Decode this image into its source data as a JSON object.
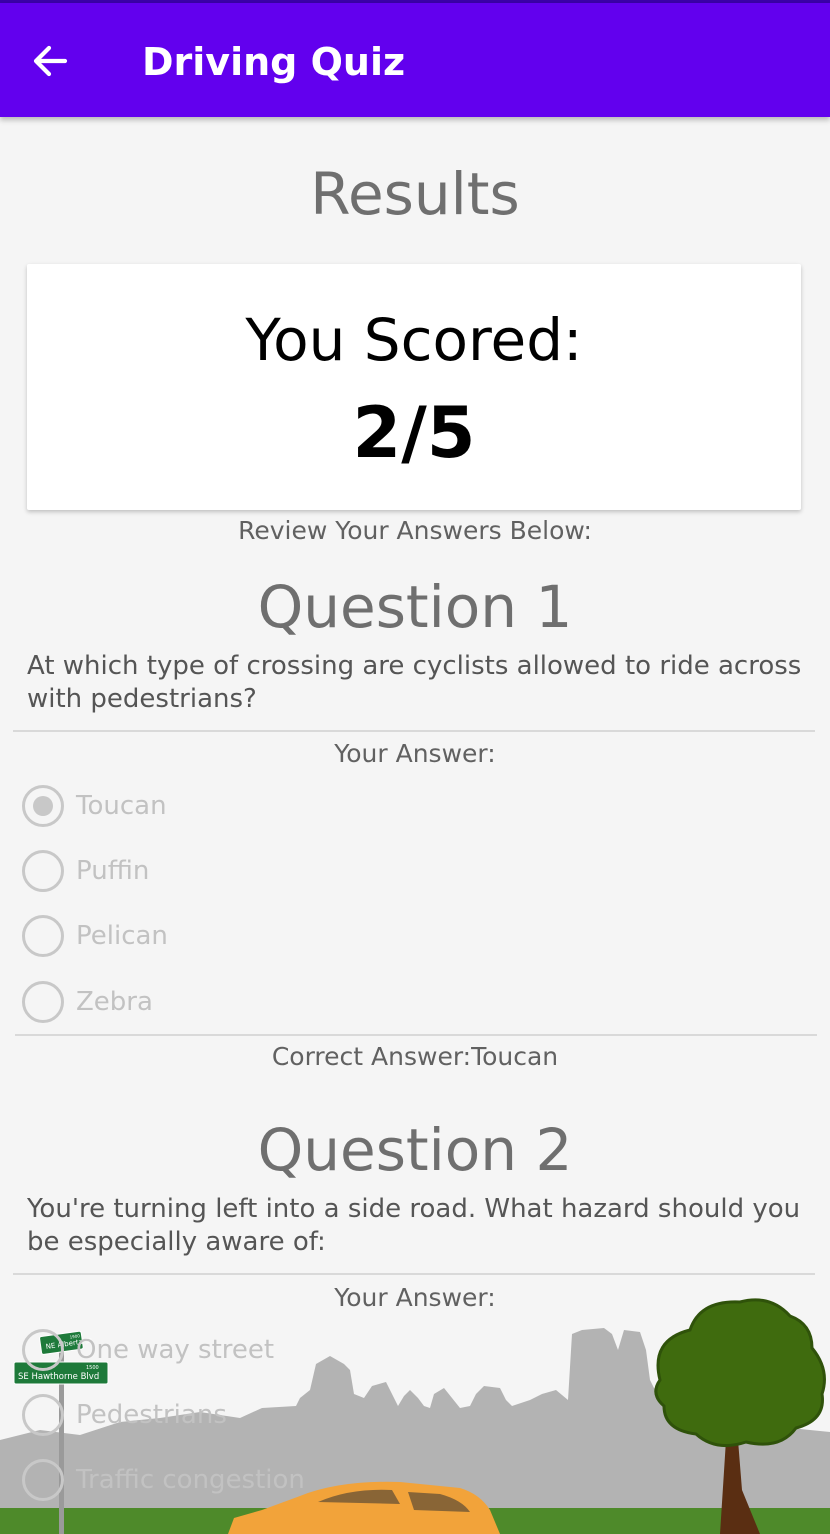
{
  "app_bar": {
    "title": "Driving Quiz",
    "back_icon": "arrow-back-icon",
    "color": "#6200ee"
  },
  "results": {
    "title": "Results",
    "score_label": "You Scored:",
    "score_value": "2/5",
    "review_label": "Review Your Answers Below:"
  },
  "questions": [
    {
      "title": "Question 1",
      "text": "At which type of crossing are cyclists allowed to ride across with pedestrians?",
      "your_answer_label": "Your Answer:",
      "options": [
        {
          "label": "Toucan",
          "selected": true
        },
        {
          "label": "Puffin",
          "selected": false
        },
        {
          "label": "Pelican",
          "selected": false
        },
        {
          "label": "Zebra",
          "selected": false
        }
      ],
      "correct_answer": "Correct Answer:Toucan"
    },
    {
      "title": "Question 2",
      "text": "You're turning left into a side road. What hazard should you be especially aware of:",
      "your_answer_label": "Your Answer:",
      "options": [
        {
          "label": "One way street",
          "selected": false
        },
        {
          "label": "Pedestrians",
          "selected": false
        },
        {
          "label": "Traffic congestion",
          "selected": false
        }
      ]
    }
  ],
  "scene": {
    "street_sign_top": "NE Alberta St",
    "street_sign_top_number": "1900",
    "street_sign_bottom": "SE Hawthorne Blvd",
    "street_sign_bottom_number": "1500",
    "sign_color": "#1e7a3a",
    "skyline_color": "#b3b3b3",
    "tree_color": "#3f6b0e",
    "car_color": "#f2a33a",
    "grass_color": "#4e8a2a"
  }
}
